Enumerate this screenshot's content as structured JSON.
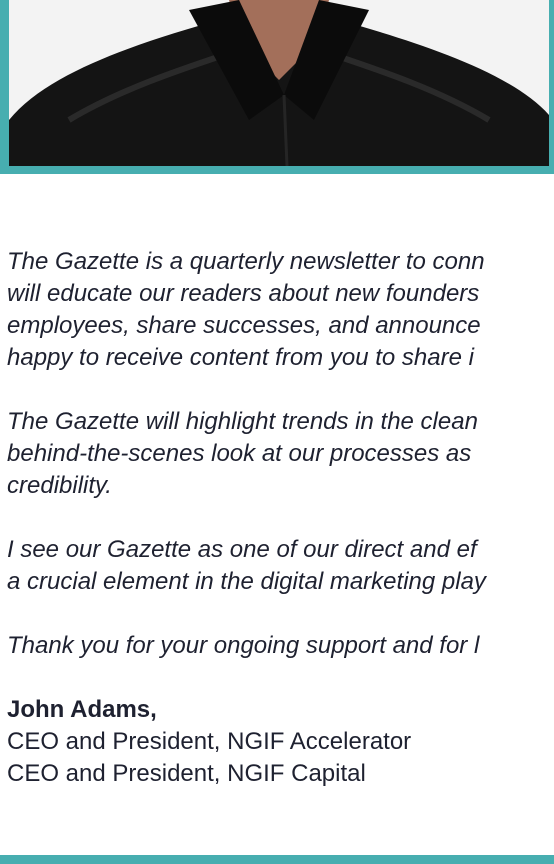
{
  "photo": {
    "subject": "portrait of man in black shirt"
  },
  "paragraphs": [
    {
      "lines": [
        "The Gazette is a quarterly newsletter to conn",
        "will educate our readers about new founders",
        "employees, share successes, and announce",
        "happy to receive content from you to share i"
      ]
    },
    {
      "lines": [
        "The Gazette will highlight trends in the clean",
        "behind-the-scenes look at our processes as",
        "credibility."
      ]
    },
    {
      "lines": [
        "I see our Gazette as one of our direct and ef",
        "a crucial element in the digital marketing play"
      ]
    },
    {
      "lines": [
        "Thank you for your ongoing support and for l"
      ]
    }
  ],
  "signature": {
    "name": "John Adams,",
    "titles": [
      "CEO and President, NGIF Accelerator",
      "CEO and President, NGIF Capital"
    ]
  },
  "colors": {
    "accent": "#47aeb0",
    "text": "#1e2130"
  }
}
